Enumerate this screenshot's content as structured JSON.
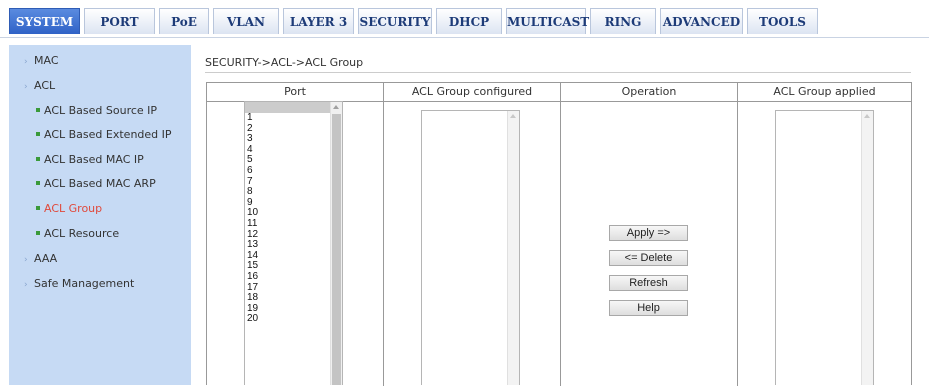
{
  "nav": {
    "tabs": [
      {
        "label": "SYSTEM",
        "active": true
      },
      {
        "label": "PORT",
        "active": false
      },
      {
        "label": "PoE",
        "active": false
      },
      {
        "label": "VLAN",
        "active": false
      },
      {
        "label": "LAYER 3",
        "active": false
      },
      {
        "label": "SECURITY",
        "active": false
      },
      {
        "label": "DHCP",
        "active": false
      },
      {
        "label": "MULTICAST",
        "active": false
      },
      {
        "label": "RING",
        "active": false
      },
      {
        "label": "ADVANCED",
        "active": false
      },
      {
        "label": "TOOLS",
        "active": false
      }
    ]
  },
  "sidebar": {
    "items": [
      {
        "label": "MAC",
        "level": 1,
        "icon": "arrow-right-icon"
      },
      {
        "label": "ACL",
        "level": 1,
        "icon": "arrow-right-icon"
      },
      {
        "label": "ACL Based Source IP",
        "level": 2,
        "icon": "bullet-icon"
      },
      {
        "label": "ACL Based Extended IP",
        "level": 2,
        "icon": "bullet-icon"
      },
      {
        "label": "ACL Based MAC IP",
        "level": 2,
        "icon": "bullet-icon"
      },
      {
        "label": "ACL Based MAC ARP",
        "level": 2,
        "icon": "bullet-icon"
      },
      {
        "label": "ACL Group",
        "level": 2,
        "icon": "bullet-icon",
        "active": true
      },
      {
        "label": "ACL Resource",
        "level": 2,
        "icon": "bullet-icon"
      },
      {
        "label": "AAA",
        "level": 1,
        "icon": "arrow-right-icon"
      },
      {
        "label": "Safe Management",
        "level": 1,
        "icon": "arrow-right-icon"
      }
    ],
    "active_color": "#e04a3c"
  },
  "main": {
    "breadcrumb": "SECURITY->ACL->ACL Group",
    "columns": {
      "port": "Port",
      "configured": "ACL Group configured",
      "operation": "Operation",
      "applied": "ACL Group applied"
    },
    "ports": [
      "1",
      "2",
      "3",
      "4",
      "5",
      "6",
      "7",
      "8",
      "9",
      "10",
      "11",
      "12",
      "13",
      "14",
      "15",
      "16",
      "17",
      "18",
      "19",
      "20"
    ],
    "buttons": {
      "apply": "Apply =>",
      "delete": "<= Delete",
      "refresh": "Refresh",
      "help": "Help"
    }
  },
  "colors": {
    "active_tab": "#2f62c7",
    "tab_text": "#1d3b78",
    "sidebar_bg": "#c6daf4"
  }
}
